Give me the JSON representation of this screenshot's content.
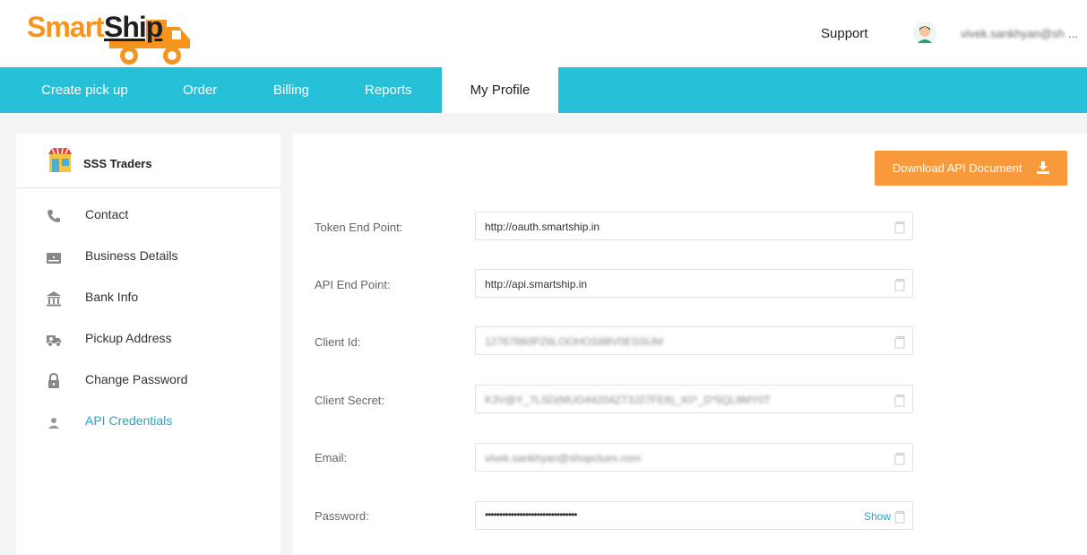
{
  "header": {
    "logo_smart": "Smart",
    "logo_ship": "Ship",
    "support": "Support",
    "user_email": "vivek.sankhyan@sh",
    "user_ellipsis": "..."
  },
  "nav": {
    "items": [
      {
        "label": "Create pick up"
      },
      {
        "label": "Order"
      },
      {
        "label": "Billing"
      },
      {
        "label": "Reports"
      },
      {
        "label": "My Profile",
        "active": true
      }
    ]
  },
  "sidebar": {
    "store_name": "SSS Traders",
    "items": [
      {
        "label": "Contact",
        "icon": "phone-icon"
      },
      {
        "label": "Business Details",
        "icon": "id-card-icon"
      },
      {
        "label": "Bank Info",
        "icon": "bank-icon"
      },
      {
        "label": "Pickup Address",
        "icon": "truck-icon"
      },
      {
        "label": "Change Password",
        "icon": "lock-icon"
      },
      {
        "label": "API Credentials",
        "icon": "user-icon",
        "active": true
      }
    ]
  },
  "main": {
    "download_label": "Download API Document",
    "fields": [
      {
        "label": "Token End Point:",
        "value": "http://oauth.smartship.in"
      },
      {
        "label": "API End Point:",
        "value": "http://api.smartship.in"
      },
      {
        "label": "Client Id:",
        "value": "12767860PZ6LOOHOS8BV0ESSUM"
      },
      {
        "label": "Client Secret:",
        "value": "K3V@Y_7LSD(MUG44204ZT3J27FE8)_X0*_D*5QL8MY0T"
      },
      {
        "label": "Email:",
        "value": "vivek.sankhyan@shopclues.com"
      },
      {
        "label": "Password:",
        "value": "••••••••••••••••••••••••••••••••",
        "show_label": "Show"
      }
    ]
  },
  "colors": {
    "brand_orange": "#f7941d",
    "nav_teal": "#27c0d9",
    "link_blue": "#27a5c4",
    "button_orange": "#f89a3b"
  }
}
